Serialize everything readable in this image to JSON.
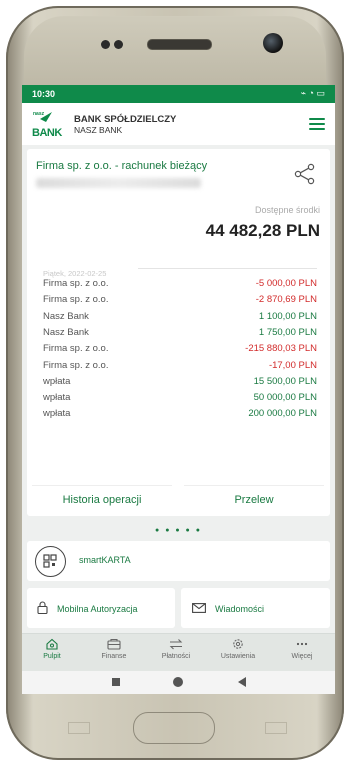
{
  "status_bar": {
    "time": "10:30",
    "icons_text": "⌁ ◔ ▭"
  },
  "header": {
    "logo_small": "nasz",
    "logo_text": "BANK",
    "bank_name": "BANK SPÓŁDZIELCZY",
    "bank_subname": "NASZ BANK"
  },
  "account": {
    "name": "Firma sp. z o.o. - rachunek bieżący",
    "available_label": "Dostępne środki",
    "balance": "44 482,28 PLN"
  },
  "transactions": {
    "date": "Piątek, 2022-02-25",
    "items": [
      {
        "name": "Firma sp. z o.o.",
        "amount": "-5 000,00 PLN",
        "type": "neg"
      },
      {
        "name": "Firma sp. z o.o.",
        "amount": "-2 870,69 PLN",
        "type": "neg"
      },
      {
        "name": "Nasz Bank",
        "amount": "1 100,00 PLN",
        "type": "pos"
      },
      {
        "name": "Nasz Bank",
        "amount": "1 750,00 PLN",
        "type": "pos"
      },
      {
        "name": "Firma sp. z o.o.",
        "amount": "-215 880,03 PLN",
        "type": "neg"
      },
      {
        "name": "Firma sp. z o.o.",
        "amount": "-17,00 PLN",
        "type": "neg"
      },
      {
        "name": "wpłata",
        "amount": "15 500,00 PLN",
        "type": "pos"
      },
      {
        "name": "wpłata",
        "amount": "50 000,00 PLN",
        "type": "pos"
      },
      {
        "name": "wpłata",
        "amount": "200 000,00 PLN",
        "type": "pos"
      }
    ]
  },
  "actions": {
    "history": "Historia operacji",
    "transfer": "Przelew"
  },
  "pager": {
    "dots": "● ● ● ● ●"
  },
  "tiles": {
    "smartkarta": "smartKARTA",
    "mobile_auth": "Mobilna Autoryzacja",
    "messages": "Wiadomości"
  },
  "bottom_nav": {
    "items": [
      {
        "label": "Pulpit",
        "icon": "home-icon"
      },
      {
        "label": "Finanse",
        "icon": "wallet-icon"
      },
      {
        "label": "Płatności",
        "icon": "transfer-arrows-icon"
      },
      {
        "label": "Ustawienia",
        "icon": "gear-icon"
      },
      {
        "label": "Więcej",
        "icon": "more-dots-icon"
      }
    ]
  },
  "colors": {
    "brand_green": "#0f8a4a",
    "negative_red": "#d22b2b",
    "positive_green": "#1a7a42"
  }
}
